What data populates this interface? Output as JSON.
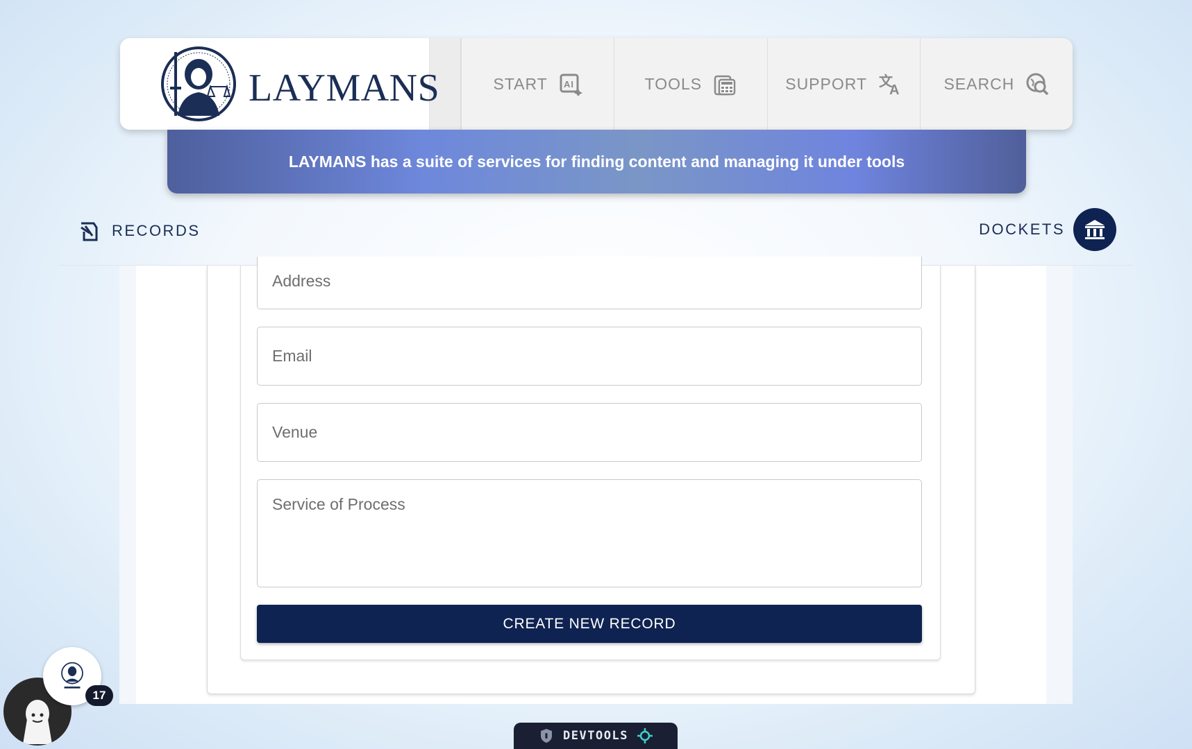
{
  "header": {
    "brand_name": "LAYMANS",
    "nav": [
      {
        "label": "START",
        "icon": "ai-sparkle-icon"
      },
      {
        "label": "TOOLS",
        "icon": "calculator-icon"
      },
      {
        "label": "SUPPORT",
        "icon": "translate-icon"
      },
      {
        "label": "SEARCH",
        "icon": "search-globe-icon"
      }
    ]
  },
  "banner": {
    "text": "LAYMANS has a suite of services for finding content and managing it under tools"
  },
  "subnav": {
    "records_label": "RECORDS",
    "dockets_label": "DOCKETS"
  },
  "form": {
    "address_placeholder": "Address",
    "email_placeholder": "Email",
    "venue_placeholder": "Venue",
    "service_placeholder": "Service of Process",
    "submit_label": "CREATE NEW RECORD"
  },
  "widgets": {
    "notification_count": "17",
    "devtools_label": "DEVTOOLS"
  },
  "colors": {
    "navy": "#0e2352",
    "banner_gradient_mid": "#7a96c6"
  }
}
